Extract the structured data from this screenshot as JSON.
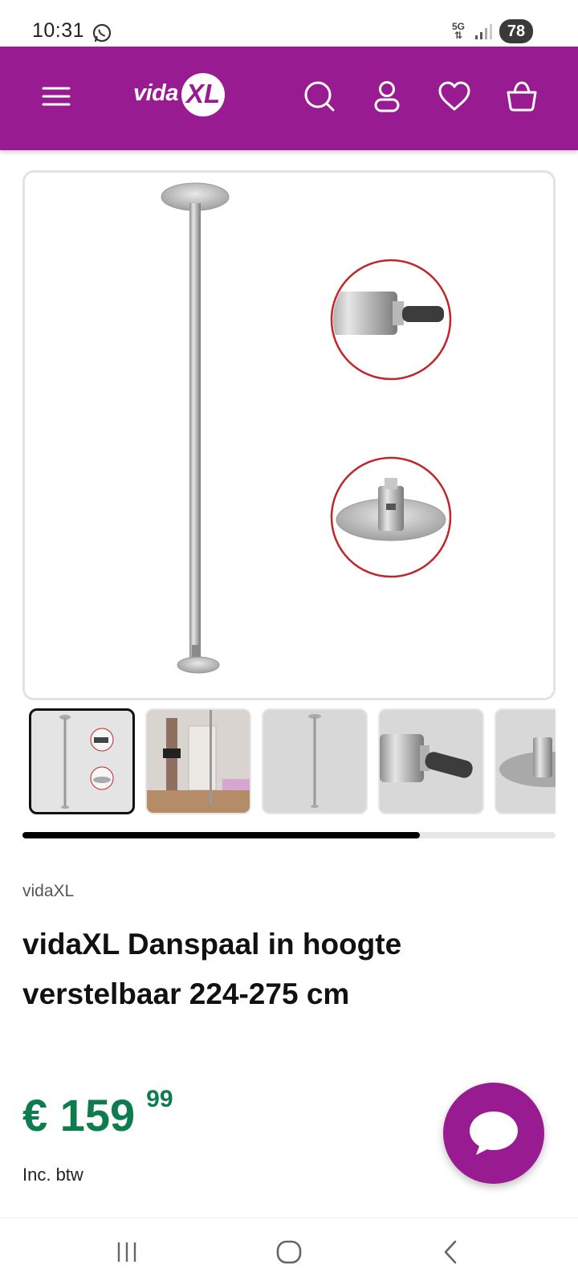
{
  "status_bar": {
    "time": "10:31",
    "network": "5G",
    "battery": "78",
    "notification_icons": [
      "whatsapp-icon"
    ],
    "system_icons": [
      "5g-icon",
      "signal-icon",
      "battery-icon"
    ]
  },
  "header": {
    "brand_logo_text": "vida",
    "brand_logo_badge": "XL",
    "background_color": "#991b91",
    "icons": [
      "menu-icon",
      "search-icon",
      "account-icon",
      "wishlist-icon",
      "cart-icon"
    ]
  },
  "gallery": {
    "thumbnails": [
      {
        "name": "product-overview",
        "active": true
      },
      {
        "name": "room-scene",
        "active": false
      },
      {
        "name": "pole-only",
        "active": false
      },
      {
        "name": "pole-tip-detail",
        "active": false
      },
      {
        "name": "base-plate-detail",
        "active": false
      }
    ],
    "scroll_progress": 0.745
  },
  "product": {
    "brand": "vidaXL",
    "title": "vidaXL Danspaal in hoogte verstelbaar 224-275 cm",
    "price_main": "€ 159",
    "price_cents": "99",
    "vat_note": "Inc. btw",
    "price_color": "#0d7d4e"
  },
  "chat": {
    "icon": "chat-bubble-icon",
    "color": "#991b91"
  },
  "navigation_bar": {
    "icons": [
      "recent-apps-icon",
      "home-icon",
      "back-icon"
    ]
  }
}
